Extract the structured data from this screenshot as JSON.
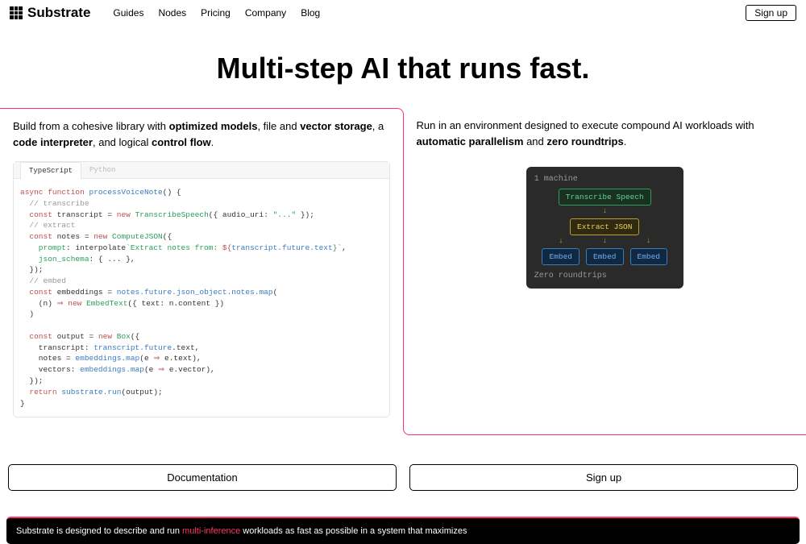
{
  "nav": {
    "brand": "Substrate",
    "links": [
      "Guides",
      "Nodes",
      "Pricing",
      "Company",
      "Blog"
    ],
    "signup": "Sign up"
  },
  "hero": {
    "title": "Multi-step AI that runs fast."
  },
  "left": {
    "text_pre": "Build from a cohesive library with ",
    "b1": "optimized models",
    "t2": ", file and ",
    "b2": "vector storage",
    "t3": ", a ",
    "b3": "code interpreter",
    "t4": ", and logical ",
    "b4": "control flow",
    "t5": "."
  },
  "code": {
    "tabs": [
      "TypeScript",
      "Python"
    ],
    "lines": {
      "l1a": "async function",
      "l1b": " processVoiceNote",
      "l1c": "() {",
      "l2": "  // transcribe",
      "l3a": "  const",
      "l3b": " transcript = ",
      "l3c": "new",
      "l3d": " TranscribeSpeech",
      "l3e": "({ audio_uri: ",
      "l3f": "\"...\"",
      "l3g": " });",
      "l4": "  // extract",
      "l5a": "  const",
      "l5b": " notes = ",
      "l5c": "new",
      "l5d": " ComputeJSON",
      "l5e": "({",
      "l6a": "    prompt",
      "l6b": ": interpolate",
      "l6c": "`Extract notes from: ",
      "l6d": "${",
      "l6e": "transcript.future.text",
      "l6f": "}`",
      "l6g": ",",
      "l7a": "    json_schema",
      "l7b": ": { ... },",
      "l8": "  });",
      "l9": "  // embed",
      "l10a": "  const",
      "l10b": " embeddings = ",
      "l10c": "notes.future.json_object.notes.map",
      "l10d": "(",
      "l11a": "    (n) ",
      "l11b": "⇒",
      "l11c": " new",
      "l11d": " EmbedText",
      "l11e": "({ text: n.content })",
      "l12": "  )",
      "l13": "",
      "l14a": "  const",
      "l14b": " output = ",
      "l14c": "new",
      "l14d": " Box",
      "l14e": "({",
      "l15a": "    transcript: ",
      "l15b": "transcript.future",
      "l15c": ".text,",
      "l16a": "    notes = ",
      "l16b": "embeddings.map",
      "l16c": "(e ",
      "l16d": "⇒",
      "l16e": " e.text),",
      "l17a": "    vectors: ",
      "l17b": "embeddings.map",
      "l17c": "(e ",
      "l17d": "⇒",
      "l17e": " e.vector),",
      "l18": "  });",
      "l19a": "  return",
      "l19b": " substrate.run",
      "l19c": "(output);",
      "l20": "}"
    }
  },
  "right": {
    "text_pre": "Run in an environment designed to execute compound AI workloads with ",
    "b1": "automatic parallelism",
    "t2": " and ",
    "b2": "zero roundtrips",
    "t3": "."
  },
  "diagram": {
    "top": "1 machine",
    "n1": "Transcribe Speech",
    "n2": "Extract JSON",
    "e1": "Embed",
    "e2": "Embed",
    "e3": "Embed",
    "bottom": "Zero roundtrips"
  },
  "cta": {
    "doc": "Documentation",
    "signup": "Sign up"
  },
  "footer": {
    "t1": "Substrate is designed to describe and run ",
    "hl": "multi-inference",
    "t2": " workloads as fast as possible in a system that maximizes"
  }
}
